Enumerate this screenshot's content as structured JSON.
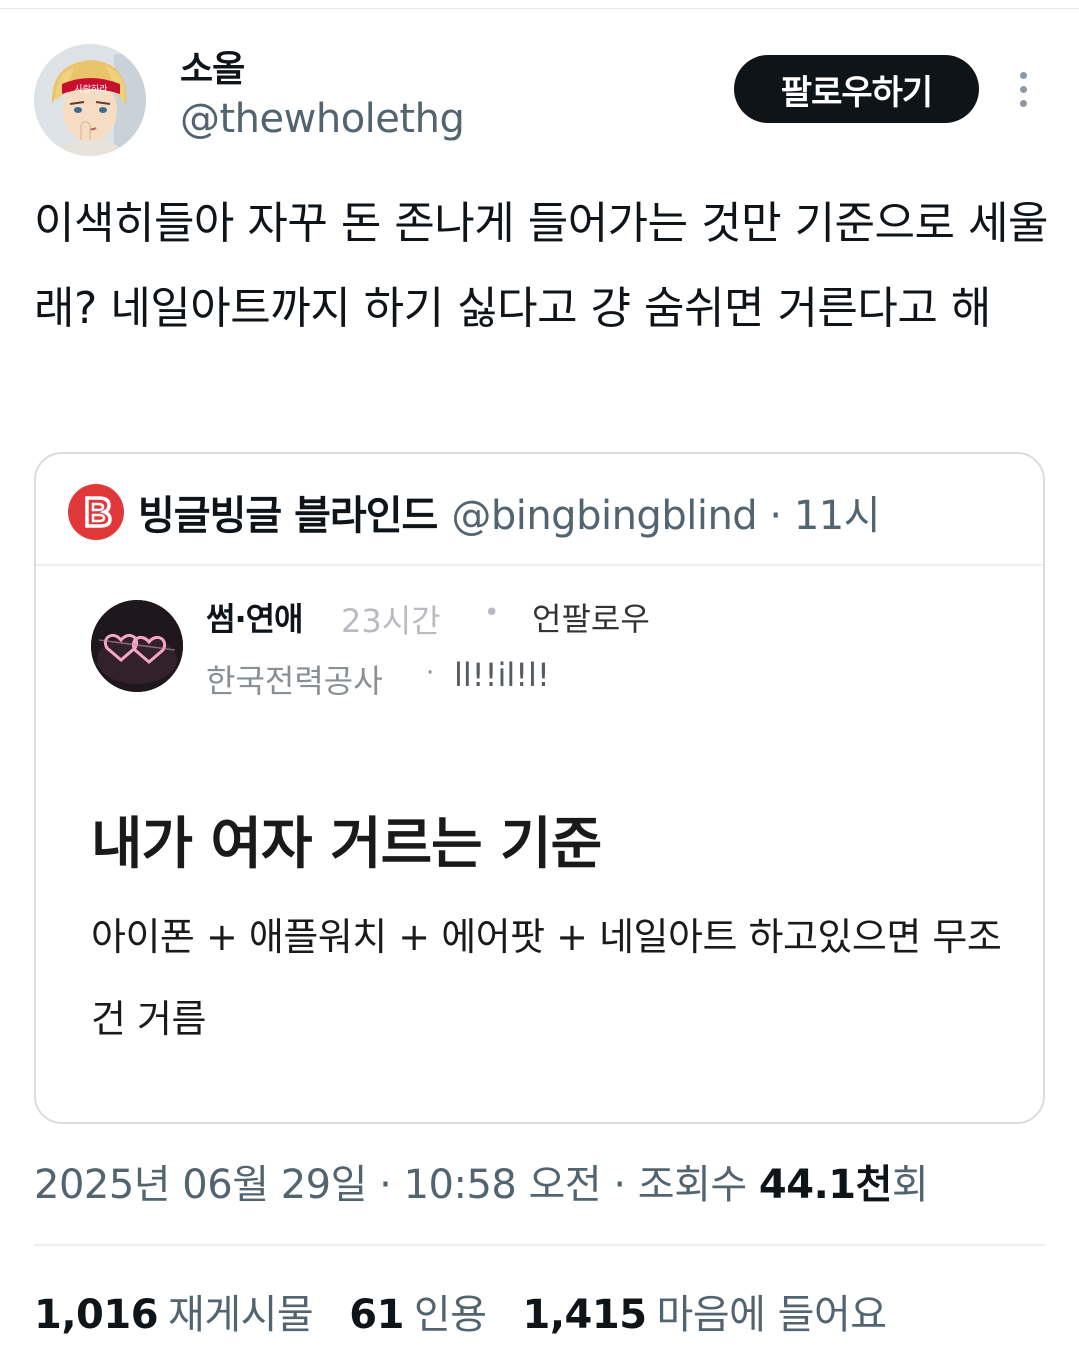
{
  "author": {
    "display_name": "소올",
    "handle": "@thewholethg",
    "avatar_headband_text": "사랑하라"
  },
  "follow_label": "팔로우하기",
  "tweet_text": "이색히들아 자꾸 돈 존나게 들어가는 것만 기준으로 세울래? 네일아트까지 하기 싫다고 걍 숨쉬면 거른다고 해",
  "quote": {
    "name": "빙글빙글 블라인드",
    "handle_time": "@bingbingblind · 11시",
    "inner": {
      "category": "썸·연애",
      "time": "23시간",
      "separator": "•",
      "unfollow": "언팔로우",
      "company": "한국전력공사",
      "separator2": "·",
      "nickname": "ll!!il!l!",
      "title": "내가 여자 거르는 기준",
      "body": "아이폰 + 애플워치 + 에어팟 + 네일아트 하고있으면 무조건 거름"
    }
  },
  "meta": {
    "datetime": "2025년 06월 29일 · 10:58 오전 · 조회수 ",
    "views_value": "44.1천",
    "views_suffix": "회"
  },
  "stats": {
    "retweets_count": "1,016",
    "retweets_label": "재게시물",
    "quotes_count": "61",
    "quotes_label": "인용",
    "likes_count": "1,415",
    "likes_label": "마음에 들어요"
  },
  "colors": {
    "text_primary": "#0f1419",
    "text_secondary": "#536471",
    "follow_bg": "#0f1419",
    "blind_logo_red": "#e1393b",
    "heart_pink": "#f3a6c6"
  },
  "icons": [
    "more-options-icon",
    "bingbing-logo-icon",
    "heart-neon-icon"
  ]
}
